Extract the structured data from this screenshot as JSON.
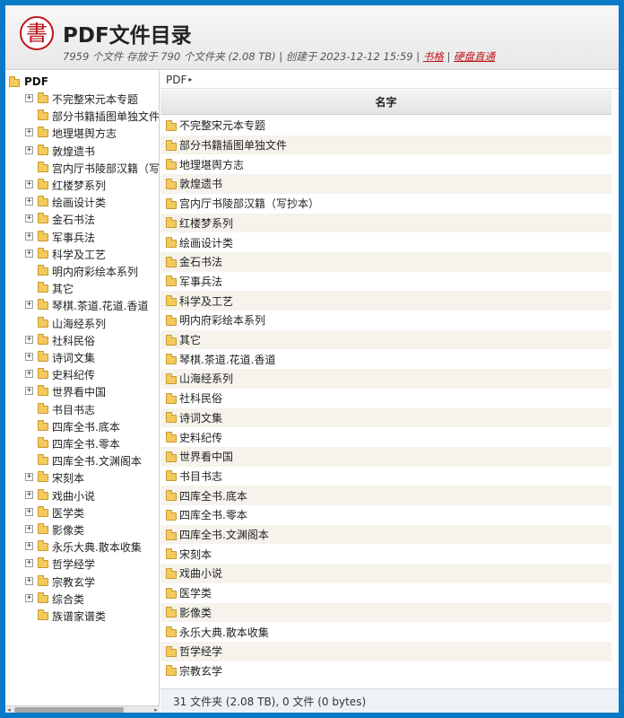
{
  "header": {
    "logo_char": "書",
    "title": "PDF文件目录",
    "stats": "7959 个文件 存放于 790 个文件夹 (2.08 TB) | 创建于 2023-12-12 15:59 | ",
    "link_books": "书格",
    "divider": " | ",
    "link_drive": "硬盘直通"
  },
  "tree": {
    "root_label": "PDF",
    "items": [
      {
        "label": "不完整宋元本专题",
        "expandable": true
      },
      {
        "label": "部分书籍插图单独文件",
        "expandable": false
      },
      {
        "label": "地理堪舆方志",
        "expandable": true
      },
      {
        "label": "敦煌遗书",
        "expandable": true
      },
      {
        "label": "宫内厅书陵部汉籍（写抄本）",
        "expandable": false
      },
      {
        "label": "红楼梦系列",
        "expandable": true
      },
      {
        "label": "绘画设计类",
        "expandable": true
      },
      {
        "label": "金石书法",
        "expandable": true
      },
      {
        "label": "军事兵法",
        "expandable": true
      },
      {
        "label": "科学及工艺",
        "expandable": true
      },
      {
        "label": "明内府彩绘本系列",
        "expandable": false
      },
      {
        "label": "其它",
        "expandable": false
      },
      {
        "label": "琴棋.茶道.花道.香道",
        "expandable": true
      },
      {
        "label": "山海经系列",
        "expandable": false
      },
      {
        "label": "社科民俗",
        "expandable": true
      },
      {
        "label": "诗词文集",
        "expandable": true
      },
      {
        "label": "史料纪传",
        "expandable": true
      },
      {
        "label": "世界看中国",
        "expandable": true
      },
      {
        "label": "书目书志",
        "expandable": false
      },
      {
        "label": "四库全书.底本",
        "expandable": false
      },
      {
        "label": "四库全书.零本",
        "expandable": false
      },
      {
        "label": "四库全书.文渊阁本",
        "expandable": false
      },
      {
        "label": "宋刻本",
        "expandable": true
      },
      {
        "label": "戏曲小说",
        "expandable": true
      },
      {
        "label": "医学类",
        "expandable": true
      },
      {
        "label": "影像类",
        "expandable": true
      },
      {
        "label": "永乐大典.散本收集",
        "expandable": true
      },
      {
        "label": "哲学经学",
        "expandable": true
      },
      {
        "label": "宗教玄学",
        "expandable": true
      },
      {
        "label": "综合类",
        "expandable": true
      },
      {
        "label": "族谱家谱类",
        "expandable": false
      }
    ]
  },
  "main": {
    "breadcrumb": "PDF",
    "breadcrumb_arrow": "▸",
    "column_name": "名字",
    "rows": [
      "不完整宋元本专题",
      "部分书籍插图单独文件",
      "地理堪舆方志",
      "敦煌遗书",
      "宫内厅书陵部汉籍（写抄本）",
      "红楼梦系列",
      "绘画设计类",
      "金石书法",
      "军事兵法",
      "科学及工艺",
      "明内府彩绘本系列",
      "其它",
      "琴棋.茶道.花道.香道",
      "山海经系列",
      "社科民俗",
      "诗词文集",
      "史料纪传",
      "世界看中国",
      "书目书志",
      "四库全书.底本",
      "四库全书.零本",
      "四库全书.文渊阁本",
      "宋刻本",
      "戏曲小说",
      "医学类",
      "影像类",
      "永乐大典.散本收集",
      "哲学经学",
      "宗教玄学"
    ],
    "footer": "31 文件夹 (2.08 TB), 0 文件 (0 bytes)"
  },
  "colors": {
    "frame": "#0a79c6",
    "logo_red": "#c0151b",
    "folder": "#f4c95d",
    "row_alt": "#f6f3ec"
  }
}
